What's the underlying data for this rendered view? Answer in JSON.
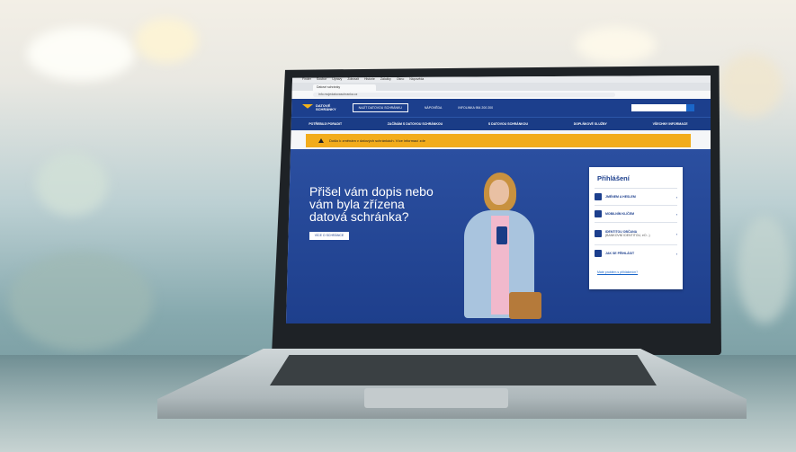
{
  "scene": {
    "description_hidden": ""
  },
  "screen": {
    "site": {
      "logo_line1": "DATOVÉ",
      "logo_line2": "SCHRÁNKY",
      "header_button": "NAJÍT DATOVOU SCHRÁNKU",
      "header_link_1": "NÁPOVĚDA",
      "header_link_2": "INFOLINKA 954 200 200",
      "search_placeholder": "Hledat",
      "nav": [
        "POTŘEBUJI PORADIT",
        "ZAČÍNÁM S DATOVOU SCHRÁNKOU",
        "S DATOVOU SCHRÁNKOU",
        "DOPLŇKOVÉ SLUŽBY",
        "VŠECHNY INFORMACE"
      ],
      "notice": "Došlo k změnám v datových schránkách. Více informací zde",
      "hero_title": "Přišel vám dopis nebo vám byla zřízena datová schránka?",
      "hero_button": "VÍCE O SCHRÁNCE",
      "login": {
        "title": "Přihlášení",
        "items": [
          {
            "label": "JMÉNEM A HESLEM",
            "sub": ""
          },
          {
            "label": "MOBILNÍM KLÍČEM",
            "sub": ""
          },
          {
            "label": "IDENTITOU OBČANA",
            "sub": "(BANKOVNÍ IDENTITOU, eO...)"
          },
          {
            "label": "JAK SE PŘIHLÁSIT",
            "sub": ""
          }
        ],
        "more_link": "Máte problém s přihlášením?"
      }
    },
    "browser": {
      "menubar": [
        "Finder",
        "Soubor",
        "Úpravy",
        "Zobrazit",
        "Historie",
        "Záložky",
        "Okno",
        "Nápověda"
      ],
      "tab_label": "Datové schránky",
      "url": "info.mojedatovaschranka.cz"
    },
    "dock_colors": [
      "#3b82f6",
      "#e5e7eb",
      "#f97316",
      "#22c55e",
      "#ef4444",
      "#a855f7",
      "#0ea5e9",
      "#eab308",
      "#f43f5e",
      "#14b8a6",
      "#6366f1",
      "#84cc16",
      "#fb923c",
      "#0284c7",
      "#dc2626",
      "#7c3aed",
      "#10b981",
      "#f59e0b",
      "#64748b",
      "#ec4899",
      "#2563eb",
      "#16a34a"
    ]
  }
}
